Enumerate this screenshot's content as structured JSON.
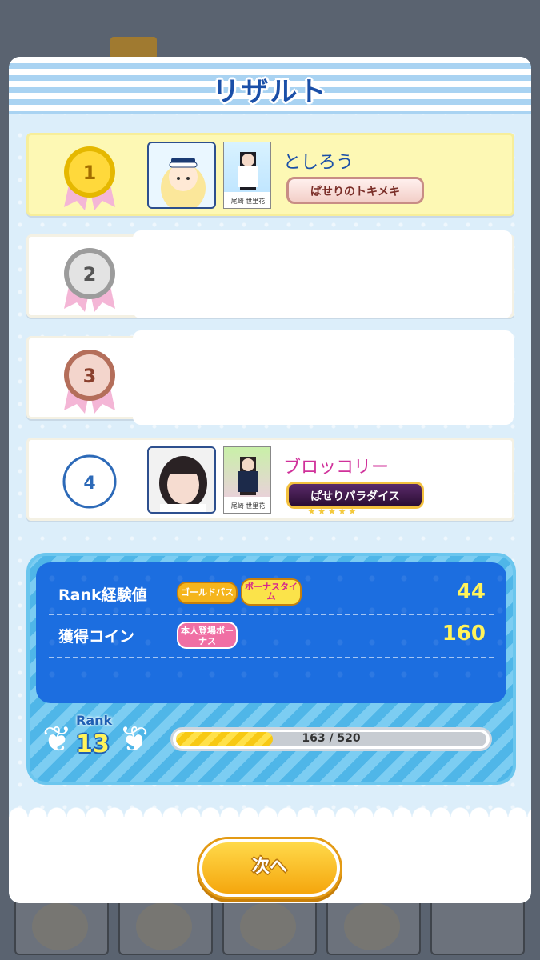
{
  "modal": {
    "title": "リザルト"
  },
  "rankings": [
    {
      "rank": "1",
      "name": "としろう",
      "title_badge": "ぱせりのトキメキ",
      "avatar_icon": "sailor-girl-avatar-icon",
      "card_label": "尾崎 世里花"
    },
    {
      "rank": "2",
      "name": "",
      "title_badge": ""
    },
    {
      "rank": "3",
      "name": "",
      "title_badge": ""
    },
    {
      "rank": "4",
      "name": "ブロッコリー",
      "title_badge": "ぱせりパラダイス",
      "avatar_icon": "photo-avatar-icon",
      "card_label": "尾崎 世里花"
    }
  ],
  "stats": {
    "rank_exp_label": "Rank経験値",
    "rank_exp_chip_gold": "ゴールドパス",
    "rank_exp_chip_bonus": "ボーナスタイム",
    "rank_exp_value": "44",
    "coin_label": "獲得コイン",
    "coin_chip": "本人登場ボーナス",
    "coin_value": "160"
  },
  "rank": {
    "label": "Rank",
    "value": "13",
    "progress_text": "163 / 520",
    "progress_fraction": 0.313
  },
  "next_button": "次へ",
  "colors": {
    "accent_blue": "#1c6ee0",
    "title_blue": "#1a4fa8",
    "yellow": "#fff35a"
  }
}
